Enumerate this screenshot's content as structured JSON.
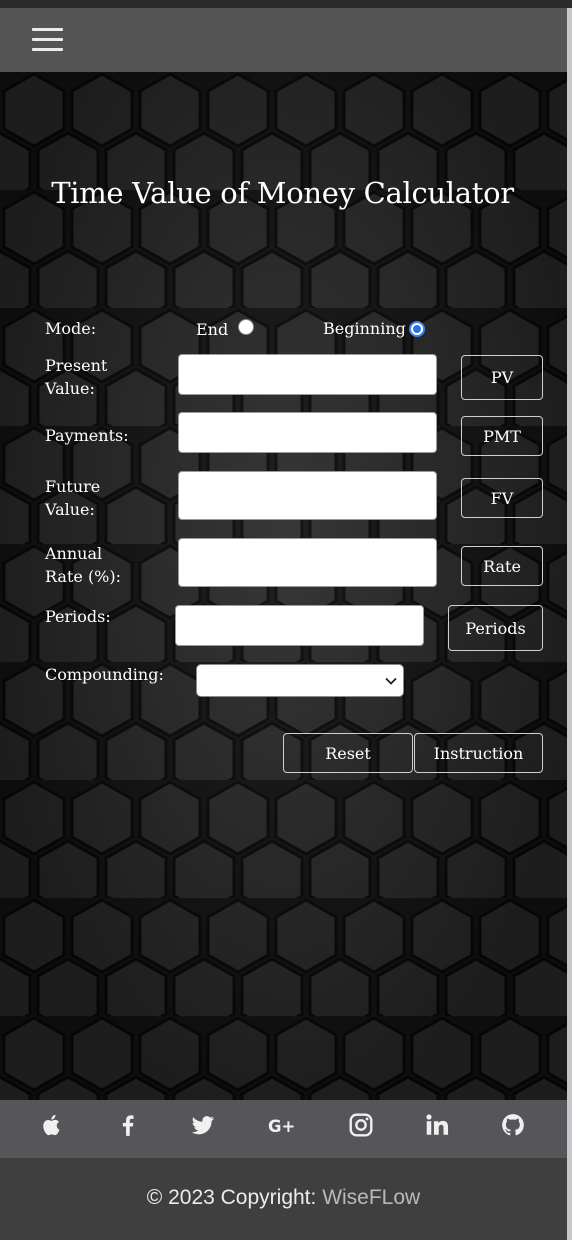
{
  "header": {
    "menu_icon": "hamburger-menu-icon"
  },
  "calculator": {
    "title": "Time Value of Money Calculator",
    "mode": {
      "label": "Mode:",
      "options": [
        {
          "label": "End",
          "checked": false
        },
        {
          "label": "Beginning",
          "checked": true
        }
      ]
    },
    "fields": [
      {
        "label_line1": "Present",
        "label_line2": "Value:",
        "value": "",
        "button": "PV"
      },
      {
        "label_line1": "Payments:",
        "label_line2": "",
        "value": "",
        "button": "PMT"
      },
      {
        "label_line1": "Future",
        "label_line2": "Value:",
        "value": "",
        "button": "FV"
      },
      {
        "label_line1": "Annual",
        "label_line2": "Rate (%):",
        "value": "",
        "button": "Rate"
      },
      {
        "label_line1": "Periods:",
        "label_line2": "",
        "value": "",
        "button": "Periods"
      }
    ],
    "compounding": {
      "label": "Compounding:",
      "value": ""
    },
    "actions": {
      "reset": "Reset",
      "instruction": "Instruction"
    }
  },
  "footer": {
    "social_icons": [
      "apple-icon",
      "facebook-icon",
      "twitter-icon",
      "google-plus-icon",
      "instagram-icon",
      "linkedin-icon",
      "github-icon"
    ],
    "copyright_prefix": "© 2023 Copyright: ",
    "copyright_brand": "WiseFLow"
  },
  "colors": {
    "radio_accent": "#2f6fe0",
    "navbar_bg": "#555556",
    "footer_bg": "#3f3f3f"
  }
}
